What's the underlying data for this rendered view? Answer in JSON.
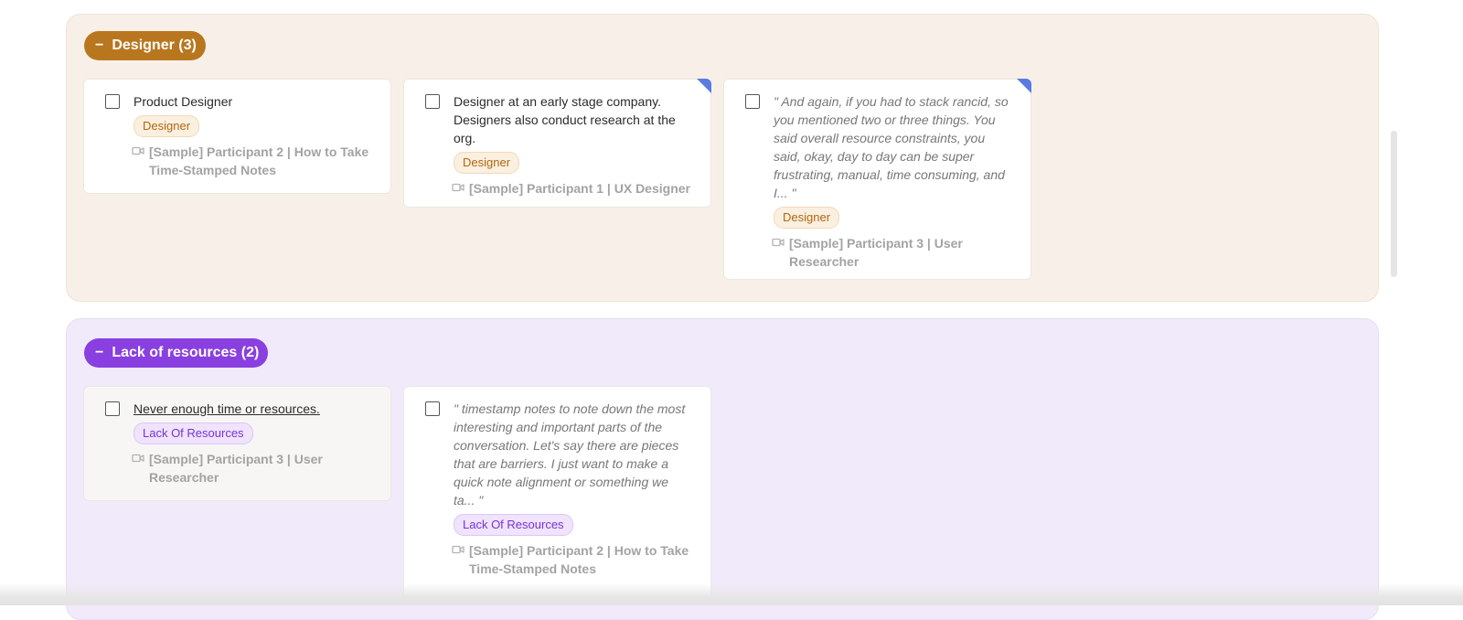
{
  "groups": {
    "designer": {
      "label": "Designer (3)",
      "cards": [
        {
          "text": "Product Designer",
          "tag": "Designer",
          "source": "[Sample] Participant 2 | How to Take Time-Stamped Notes"
        },
        {
          "text": "Designer at an early stage company. Designers also conduct research at the org.",
          "tag": "Designer",
          "source": "[Sample] Participant 1 | UX Designer"
        },
        {
          "text": "\" And again, if you had to stack rancid, so you mentioned two or three things. You said overall resource constraints, you said, okay, day to day can be super frustrating, manual, time consuming, and I... \"",
          "tag": "Designer",
          "source": "[Sample] Participant 3 | User Researcher"
        }
      ]
    },
    "lack": {
      "label": "Lack of resources (2)",
      "cards": [
        {
          "text": "Never enough time or resources.",
          "tag": "Lack Of Resources",
          "source": "[Sample] Participant 3 | User Researcher"
        },
        {
          "text": "\" timestamp notes to note down the most interesting and important parts of the conversation. Let's say there are pieces that are barriers. I just want to make a quick note alignment or something we ta... \"",
          "tag": "Lack Of Resources",
          "source": "[Sample] Participant 2 | How to Take Time-Stamped Notes"
        }
      ]
    }
  },
  "icons": {
    "collapse": "minus-icon",
    "source": "video-camera-icon",
    "checkbox": "checkbox-icon"
  },
  "colors": {
    "designer_accent": "#b8771e",
    "lack_accent": "#8a3fe0",
    "corner_marker": "#5b7be0"
  }
}
